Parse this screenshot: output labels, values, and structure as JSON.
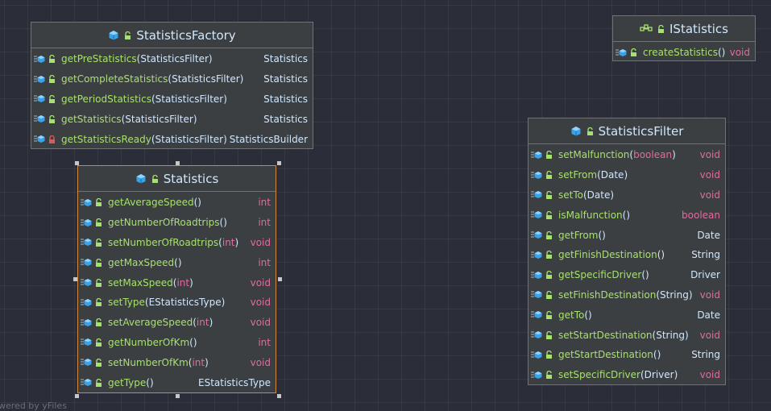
{
  "watermark": "wered by yFiles",
  "colors": {
    "name": "#a6e06e",
    "type": "#cfe7ff",
    "keyword": "#e06c9f",
    "selection": "#d0883e"
  },
  "classes": [
    {
      "id": "statistics-factory",
      "title": "StatisticsFactory",
      "kind": "class",
      "methods": [
        {
          "name": "getPreStatistics",
          "params": [
            {
              "t": "(StatisticsFilter)",
              "kw": false
            }
          ],
          "ret": "Statistics",
          "retKw": false,
          "access": "public"
        },
        {
          "name": "getCompleteStatistics",
          "params": [
            {
              "t": "(StatisticsFilter)",
              "kw": false
            }
          ],
          "ret": "Statistics",
          "retKw": false,
          "access": "public"
        },
        {
          "name": "getPeriodStatistics",
          "params": [
            {
              "t": "(StatisticsFilter)",
              "kw": false
            }
          ],
          "ret": "Statistics",
          "retKw": false,
          "access": "public"
        },
        {
          "name": "getStatistics",
          "params": [
            {
              "t": "(StatisticsFilter)",
              "kw": false
            }
          ],
          "ret": "Statistics",
          "retKw": false,
          "access": "public"
        },
        {
          "name": "getStatisticsReady",
          "params": [
            {
              "t": "(StatisticsFilter)",
              "kw": false
            }
          ],
          "ret": "StatisticsBuilder",
          "retKw": false,
          "access": "private"
        }
      ]
    },
    {
      "id": "istatistics",
      "title": "IStatistics",
      "kind": "interface",
      "methods": [
        {
          "name": "createStatistics",
          "params": [
            {
              "t": "()",
              "kw": false
            }
          ],
          "ret": "void",
          "retKw": true,
          "access": "public"
        }
      ]
    },
    {
      "id": "statistics",
      "title": "Statistics",
      "kind": "class",
      "selected": true,
      "methods": [
        {
          "name": "getAverageSpeed",
          "params": [
            {
              "t": " ()",
              "kw": false
            }
          ],
          "ret": "int",
          "retKw": true,
          "access": "public"
        },
        {
          "name": "getNumberOfRoadtrips",
          "params": [
            {
              "t": " ()",
              "kw": false
            }
          ],
          "ret": "int",
          "retKw": true,
          "access": "public"
        },
        {
          "name": "setNumberOfRoadtrips",
          "params": [
            {
              "t": " (",
              "kw": false
            },
            {
              "t": "int",
              "kw": true
            },
            {
              "t": ")",
              "kw": false
            }
          ],
          "ret": "void",
          "retKw": true,
          "access": "public"
        },
        {
          "name": "getMaxSpeed",
          "params": [
            {
              "t": " ()",
              "kw": false
            }
          ],
          "ret": "int",
          "retKw": true,
          "access": "public"
        },
        {
          "name": "setMaxSpeed",
          "params": [
            {
              "t": " (",
              "kw": false
            },
            {
              "t": "int",
              "kw": true
            },
            {
              "t": ")",
              "kw": false
            }
          ],
          "ret": "void",
          "retKw": true,
          "access": "public"
        },
        {
          "name": "setType",
          "params": [
            {
              "t": "(EStatisticsType)",
              "kw": false
            }
          ],
          "ret": "void",
          "retKw": true,
          "access": "public"
        },
        {
          "name": "setAverageSpeed",
          "params": [
            {
              "t": "  (",
              "kw": false
            },
            {
              "t": "int",
              "kw": true
            },
            {
              "t": ")",
              "kw": false
            }
          ],
          "ret": "void",
          "retKw": true,
          "access": "public"
        },
        {
          "name": "getNumberOfKm",
          "params": [
            {
              "t": " ()",
              "kw": false
            }
          ],
          "ret": "int",
          "retKw": true,
          "access": "public"
        },
        {
          "name": "setNumberOfKm",
          "params": [
            {
              "t": " (",
              "kw": false
            },
            {
              "t": "int",
              "kw": true
            },
            {
              "t": ")",
              "kw": false
            }
          ],
          "ret": "void",
          "retKw": true,
          "access": "public"
        },
        {
          "name": "getType",
          "params": [
            {
              "t": " ()",
              "kw": false
            }
          ],
          "ret": "EStatisticsType",
          "retKw": false,
          "access": "public"
        }
      ]
    },
    {
      "id": "statistics-filter",
      "title": "StatisticsFilter",
      "kind": "class",
      "methods": [
        {
          "name": "setMalfunction",
          "params": [
            {
              "t": "(",
              "kw": false
            },
            {
              "t": "boolean",
              "kw": true
            },
            {
              "t": ")",
              "kw": false
            }
          ],
          "ret": "void",
          "retKw": true,
          "access": "public"
        },
        {
          "name": "setFrom",
          "params": [
            {
              "t": "(Date)",
              "kw": false
            }
          ],
          "ret": "void",
          "retKw": true,
          "access": "public"
        },
        {
          "name": "setTo",
          "params": [
            {
              "t": "(Date)",
              "kw": false
            }
          ],
          "ret": "void",
          "retKw": true,
          "access": "public"
        },
        {
          "name": "isMalfunction",
          "params": [
            {
              "t": "()",
              "kw": false
            }
          ],
          "ret": "boolean",
          "retKw": true,
          "access": "public"
        },
        {
          "name": "getFrom",
          "params": [
            {
              "t": "()",
              "kw": false
            }
          ],
          "ret": "Date",
          "retKw": false,
          "access": "public"
        },
        {
          "name": "getFinishDestination",
          "params": [
            {
              "t": " ()",
              "kw": false
            }
          ],
          "ret": "String",
          "retKw": false,
          "access": "public"
        },
        {
          "name": "getSpecificDriver",
          "params": [
            {
              "t": " ()",
              "kw": false
            }
          ],
          "ret": "Driver",
          "retKw": false,
          "access": "public"
        },
        {
          "name": "setFinishDestination",
          "params": [
            {
              "t": "(String)",
              "kw": false
            }
          ],
          "ret": "void",
          "retKw": true,
          "access": "public"
        },
        {
          "name": "getTo",
          "params": [
            {
              "t": "()",
              "kw": false
            }
          ],
          "ret": "Date",
          "retKw": false,
          "access": "public"
        },
        {
          "name": "setStartDestination",
          "params": [
            {
              "t": "(String)",
              "kw": false
            }
          ],
          "ret": "void",
          "retKw": true,
          "access": "public"
        },
        {
          "name": "getStartDestination",
          "params": [
            {
              "t": " ()",
              "kw": false
            }
          ],
          "ret": "String",
          "retKw": false,
          "access": "public"
        },
        {
          "name": "setSpecificDriver",
          "params": [
            {
              "t": " (Driver)",
              "kw": false
            }
          ],
          "ret": "void",
          "retKw": true,
          "access": "public"
        }
      ]
    }
  ]
}
